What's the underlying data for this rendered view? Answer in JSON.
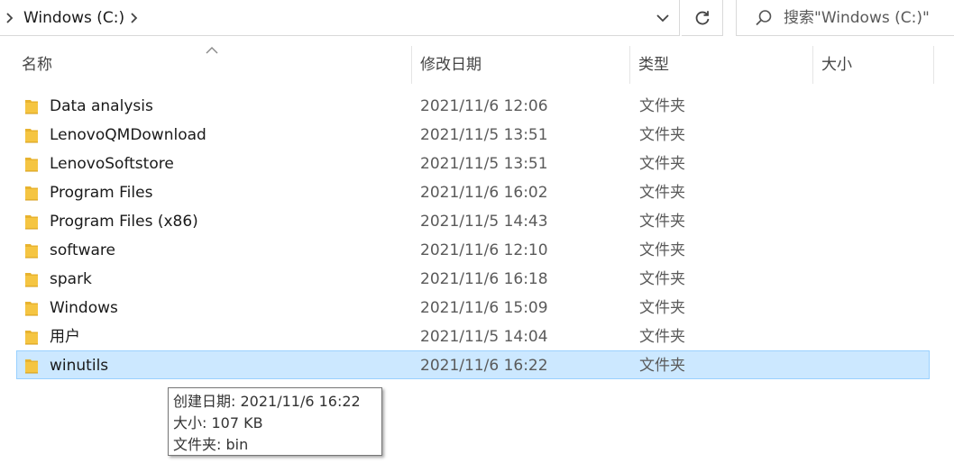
{
  "address_bar": {
    "crumb": "Windows (C:)"
  },
  "search": {
    "placeholder": "搜索\"Windows (C:)\""
  },
  "columns": {
    "name": "名称",
    "date": "修改日期",
    "type": "类型",
    "size": "大小"
  },
  "files": [
    {
      "name": "Data analysis",
      "date": "2021/11/6 12:06",
      "type": "文件夹",
      "size": ""
    },
    {
      "name": "LenovoQMDownload",
      "date": "2021/11/5 13:51",
      "type": "文件夹",
      "size": ""
    },
    {
      "name": "LenovoSoftstore",
      "date": "2021/11/5 13:51",
      "type": "文件夹",
      "size": ""
    },
    {
      "name": "Program Files",
      "date": "2021/11/6 16:02",
      "type": "文件夹",
      "size": ""
    },
    {
      "name": "Program Files (x86)",
      "date": "2021/11/5 14:43",
      "type": "文件夹",
      "size": ""
    },
    {
      "name": "software",
      "date": "2021/11/6 12:10",
      "type": "文件夹",
      "size": ""
    },
    {
      "name": "spark",
      "date": "2021/11/6 16:18",
      "type": "文件夹",
      "size": ""
    },
    {
      "name": "Windows",
      "date": "2021/11/6 15:09",
      "type": "文件夹",
      "size": ""
    },
    {
      "name": "用户",
      "date": "2021/11/5 14:04",
      "type": "文件夹",
      "size": ""
    },
    {
      "name": "winutils",
      "date": "2021/11/6 16:22",
      "type": "文件夹",
      "size": ""
    }
  ],
  "selected_index": 9,
  "tooltip": {
    "line1": "创建日期: 2021/11/6 16:22",
    "line2": "大小: 107 KB",
    "line3": "文件夹: bin"
  },
  "colors": {
    "selection_bg": "#cce8ff",
    "selection_border": "#99d1ff",
    "folder": "#f5c542"
  },
  "icons": {
    "address_lead": "chevron-right-icon",
    "address_after": "chevron-right-icon",
    "dropdown": "chevron-down-icon",
    "refresh": "refresh-icon",
    "search": "search-icon",
    "folder": "folder-icon",
    "sort": "sort-up-icon"
  }
}
